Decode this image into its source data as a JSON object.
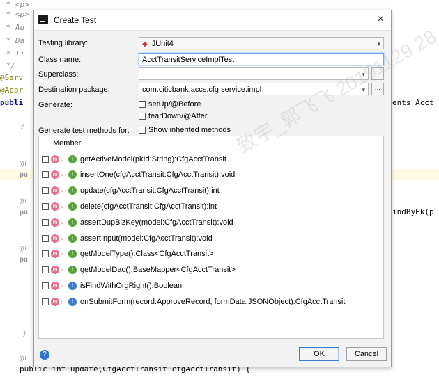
{
  "editor": {
    "lines": [
      {
        "text": " * <p>",
        "cls": "c-comment"
      },
      {
        "text": " * <p>",
        "cls": "c-comment"
      },
      {
        "text": " * Au",
        "cls": "c-comment"
      },
      {
        "text": " * Da",
        "cls": "c-comment"
      },
      {
        "text": " * Ti",
        "cls": "c-comment"
      },
      {
        "text": " */",
        "cls": "c-comment"
      },
      {
        "text": "@Serv",
        "cls": "c-annot"
      },
      {
        "text": "@Appr",
        "cls": "c-annot"
      },
      {
        "text": "publi",
        "cls": "c-kw"
      }
    ],
    "right_fragments": [
      "ents Acct",
      "indByPk(p"
    ],
    "bottom_line": "public int update(CfgAcctTransit cfgAcctTransit) {",
    "side_markers": [
      "@(",
      "pu",
      "@(",
      "pu",
      "@(",
      "pu",
      "@("
    ],
    "misc": [
      "/",
      "}"
    ]
  },
  "dialog": {
    "title": "Create Test",
    "close_label": "×",
    "testing_library": {
      "label": "Testing library:",
      "value": "JUnit4"
    },
    "class_name": {
      "label": "Class name:",
      "value": "AcctTransitServiceImplTest"
    },
    "superclass": {
      "label": "Superclass:",
      "value": ""
    },
    "destination_package": {
      "label": "Destination package:",
      "value": "com.citicbank.accs.cfg.service.impl"
    },
    "generate": {
      "label": "Generate:",
      "options": [
        "setUp/@Before",
        "tearDown/@After"
      ]
    },
    "generate_methods": {
      "label": "Generate test methods for:",
      "show_inherited": "Show inherited methods"
    },
    "ellipsis_label": "...",
    "list_header": "Member",
    "members": [
      {
        "sig": "getActiveModel(pkId:String):CfgAcctTransit",
        "vis": "public",
        "kind": "green"
      },
      {
        "sig": "insertOne(cfgAcctTransit:CfgAcctTransit):void",
        "vis": "public",
        "kind": "green"
      },
      {
        "sig": "update(cfgAcctTransit:CfgAcctTransit):int",
        "vis": "public",
        "kind": "green"
      },
      {
        "sig": "delete(cfgAcctTransit:CfgAcctTransit):int",
        "vis": "public",
        "kind": "green"
      },
      {
        "sig": "assertDupBizKey(model:CfgAcctTransit):void",
        "vis": "public",
        "kind": "green"
      },
      {
        "sig": "assertInput(model:CfgAcctTransit):void",
        "vis": "public",
        "kind": "green"
      },
      {
        "sig": "getModelType():Class<CfgAcctTransit>",
        "vis": "protected",
        "kind": "green"
      },
      {
        "sig": "getModelDao():BaseMapper<CfgAcctTransit>",
        "vis": "protected",
        "kind": "green"
      },
      {
        "sig": "isFindWithOrgRight():Boolean",
        "vis": "protected",
        "kind": "blue"
      },
      {
        "sig": "onSubmitForm(record:ApproveRecord, formData:JSONObject):CfgAcctTransit",
        "vis": "public",
        "kind": "blue"
      }
    ],
    "help_label": "?",
    "ok_label": "OK",
    "cancel_label": "Cancel"
  },
  "watermark": "致宇_郭飞飞 20191129 28"
}
